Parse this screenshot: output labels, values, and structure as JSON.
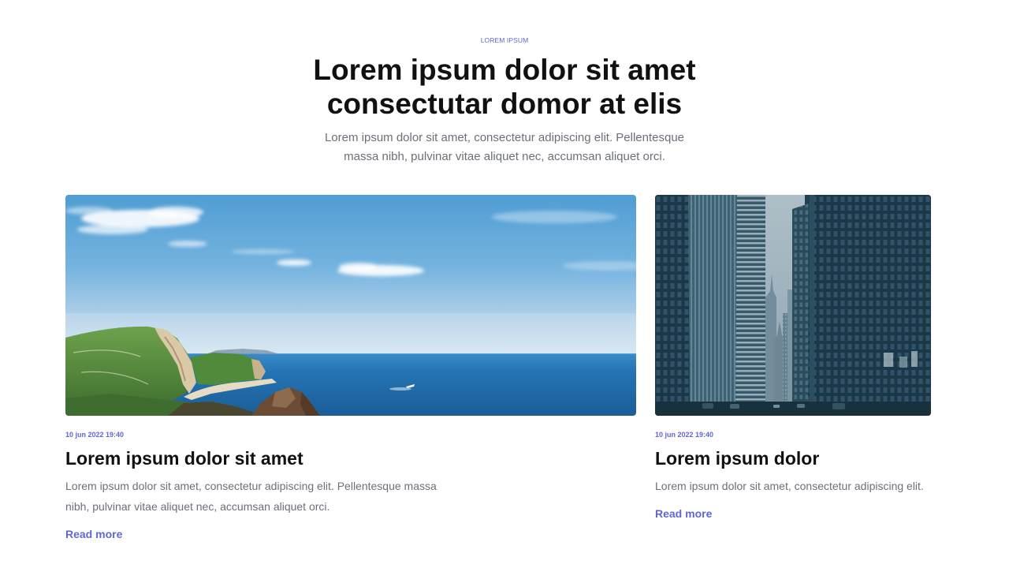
{
  "section": {
    "eyebrow": "LOREM IPSUM",
    "title": "Lorem ipsum dolor sit amet consectutar domor at elis",
    "subtitle": "Lorem ipsum dolor sit amet, consectetur adipiscing elit. Pellentesque massa nibh, pulvinar vitae aliquet nec, accumsan aliquet orci."
  },
  "posts": [
    {
      "date": "10 jun 2022 19:40",
      "title": "Lorem ipsum dolor sit amet",
      "excerpt": "Lorem ipsum dolor sit amet, consectetur adipiscing elit. Pellentesque massa nibh, pulvinar vitae aliquet nec, accumsan aliquet orci.",
      "link_label": "Read more"
    },
    {
      "date": "10 jun 2022 19:40",
      "title": "Lorem ipsum dolor",
      "excerpt": "Lorem ipsum dolor sit amet, consectetur adipiscing elit.",
      "link_label": "Read more"
    }
  ],
  "colors": {
    "accent": "#6366d1",
    "heading": "#111111",
    "text": "#6b6f7a",
    "background": "#ffffff"
  }
}
